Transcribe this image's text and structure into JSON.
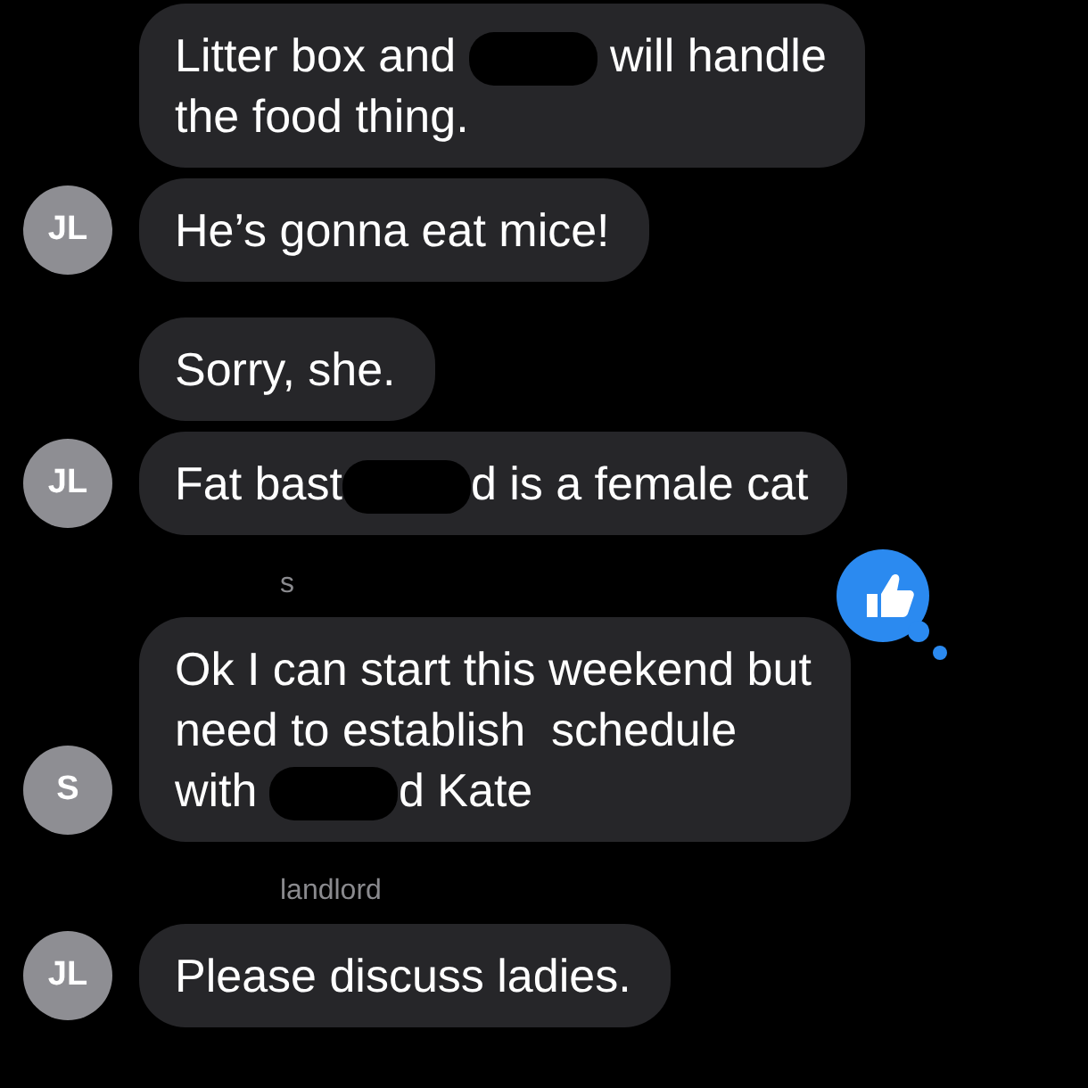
{
  "messages": [
    {
      "lines": [
        [
          {
            "kind": "text",
            "text": "Litter box and "
          },
          {
            "kind": "redacted"
          },
          {
            "kind": "text",
            "text": " will handle"
          }
        ],
        [
          {
            "kind": "text",
            "text": "the food thing."
          }
        ]
      ]
    },
    {
      "avatar": "JL",
      "lines": [
        [
          {
            "kind": "text",
            "text": "He’s gonna eat mice!"
          }
        ]
      ]
    },
    {
      "lines": [
        [
          {
            "kind": "text",
            "text": "Sorry, she."
          }
        ]
      ]
    },
    {
      "avatar": "JL",
      "lines": [
        [
          {
            "kind": "text",
            "text": "Fat bast"
          },
          {
            "kind": "redacted"
          },
          {
            "kind": "text",
            "text": "d is a female cat"
          }
        ]
      ]
    },
    {
      "sender": "s",
      "avatar": "S",
      "liked": true,
      "lines": [
        [
          {
            "kind": "text",
            "text": "Ok I can start this weekend but"
          }
        ],
        [
          {
            "kind": "text",
            "text": "need to establish  schedule"
          }
        ],
        [
          {
            "kind": "text",
            "text": "with "
          },
          {
            "kind": "redacted"
          },
          {
            "kind": "text",
            "text": "d Kate"
          }
        ]
      ]
    },
    {
      "sender": "landlord",
      "avatar": "JL",
      "lines": [
        [
          {
            "kind": "text",
            "text": "Please discuss ladies."
          }
        ]
      ]
    }
  ]
}
